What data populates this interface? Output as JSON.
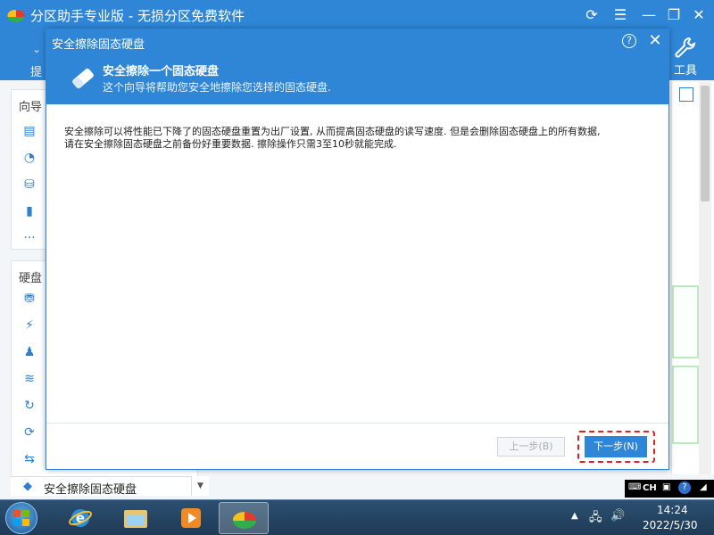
{
  "app": {
    "title": "分区助手专业版 - 无损分区免费软件",
    "ribbon_left_partial": "提",
    "tool_label": "工具"
  },
  "sidebar": {
    "wizard_head": "向导",
    "disk_head": "硬盘"
  },
  "status": {
    "operation_label": "安全擦除固态硬盘"
  },
  "dialog": {
    "title": "安全擦除固态硬盘",
    "header_title": "安全擦除一个固态硬盘",
    "header_subtitle": "这个向导将帮助您安全地擦除您选择的固态硬盘.",
    "body_line1": "安全擦除可以将性能已下降了的固态硬盘重置为出厂设置, 从而提高固态硬盘的读写速度. 但是会删除固态硬盘上的所有数据,",
    "body_line2": "请在安全擦除固态硬盘之前备份好重要数据. 擦除操作只需3至10秒就能完成.",
    "prev_label": "上一步(B)",
    "next_label": "下一步(N)",
    "help_symbol": "?",
    "close_symbol": "✕"
  },
  "ime": {
    "lang": "CH"
  },
  "taskbar": {
    "time": "14:24",
    "date": "2022/5/30"
  },
  "colors": {
    "accent": "#2f86d7",
    "highlight_outline": "#e02020"
  }
}
